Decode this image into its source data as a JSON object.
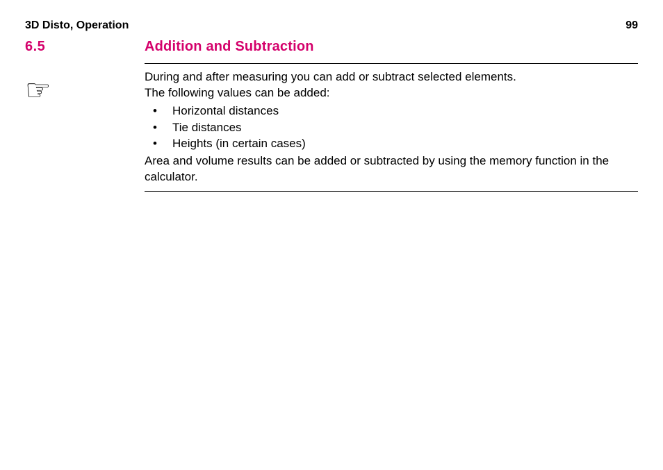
{
  "header": {
    "left": "3D Disto, Operation",
    "page": "99"
  },
  "section": {
    "number": "6.5",
    "title": "Addition and Subtraction"
  },
  "content": {
    "intro1": "During and after measuring you can add or subtract selected elements.",
    "intro2": "The following values can be added:",
    "bullets": [
      "Horizontal distances",
      "Tie distances",
      "Heights (in certain cases)"
    ],
    "closing": "Area and volume results can be added or subtracted by using the memory function in the calculator."
  },
  "icons": {
    "hand": "☞"
  }
}
